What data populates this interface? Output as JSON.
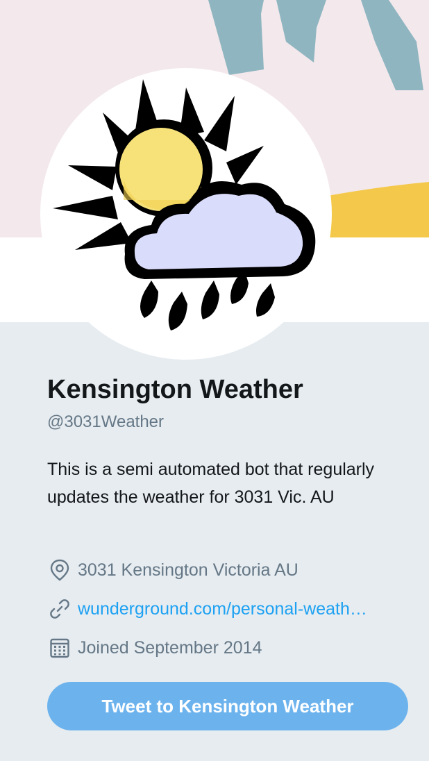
{
  "profile": {
    "name": "Kensington Weather",
    "handle": "@3031Weather",
    "bio": "This is a semi automated bot that regularly updates the weather for 3031 Vic. AU",
    "location": "3031 Kensington Victoria AU",
    "website": "wunderground.com/personal-weath…",
    "joined": "Joined September 2014",
    "avatar_icon": "weather-sun-cloud-rain-icon"
  },
  "actions": {
    "tweet_to_label": "Tweet to Kensington Weather"
  },
  "icons": {
    "location": "location-pin-icon",
    "link": "link-icon",
    "calendar": "calendar-icon"
  },
  "colors": {
    "background": "#e6ecf0",
    "link": "#1da1f2",
    "button": "#6cb3ee",
    "muted_text": "#657786",
    "primary_text": "#14171a"
  }
}
